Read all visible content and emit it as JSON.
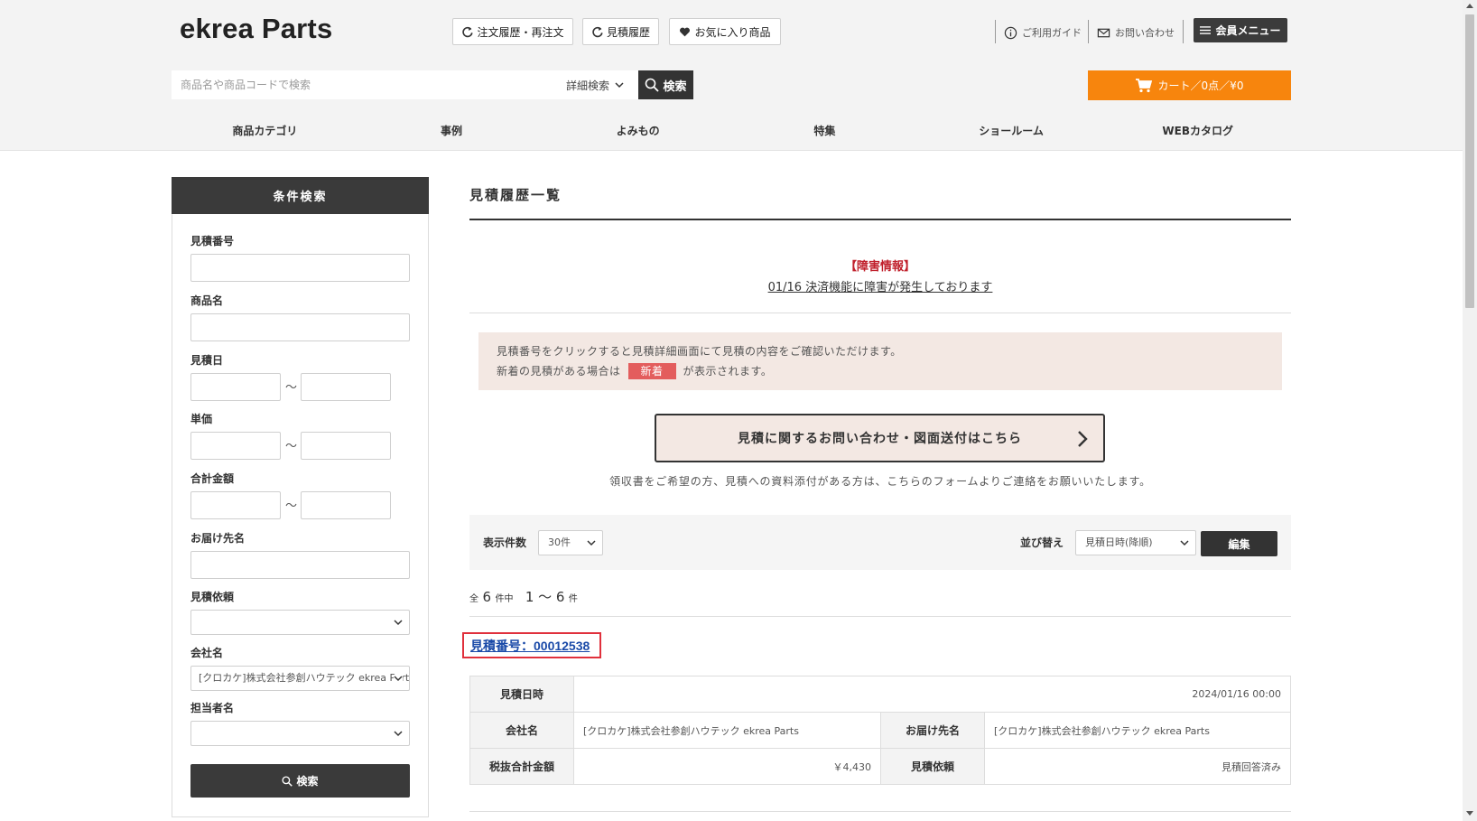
{
  "header": {
    "logo": "ekrea Parts",
    "buttons": {
      "order_history": "注文履歴・再注文",
      "quote_history": "見積履歴",
      "favorites": "お気に入り商品"
    },
    "utility": {
      "guide": "ご利用ガイド",
      "contact": "お問い合わせ",
      "member_menu": "会員メニュー"
    },
    "search": {
      "placeholder": "商品名や商品コードで検索",
      "detail": "詳細検索",
      "button": "検索"
    },
    "cart": "カート／0点／¥0",
    "nav": [
      "商品カテゴリ",
      "事例",
      "よみもの",
      "特集",
      "ショールーム",
      "WEBカタログ"
    ]
  },
  "sidebar": {
    "title": "条件検索",
    "fields": {
      "quote_number": "見積番号",
      "product_name": "商品名",
      "quote_date": "見積日",
      "unit_price": "単価",
      "total_amount": "合計金額",
      "delivery_name": "お届け先名",
      "quote_request": "見積依頼",
      "company_name": "会社名",
      "person_name": "担当者名"
    },
    "tilde": "～",
    "company_value": "[クロカケ]株式会社参創ハウテック ekrea Parts",
    "search_button": "検索"
  },
  "main": {
    "title": "見積履歴一覧",
    "alert_tag": "【障害情報】",
    "alert_link": "01/16 決済機能に障害が発生しております",
    "notice_line1": "見積番号をクリックすると見積詳細画面にて見積の内容をご確認いただけます。",
    "notice_line2_pre": "新着の見積がある場合は",
    "notice_badge": "新着",
    "notice_line2_post": "が表示されます。",
    "contact_button": "見積に関するお問い合わせ・図面送付はこちら",
    "contact_note": "領収書をご希望の方、見積への資料添付がある方は、こちらのフォームよりご連絡をお願いいたします。",
    "toolbar": {
      "per_page_label": "表示件数",
      "per_page_value": "30件",
      "sort_label": "並び替え",
      "sort_value": "見積日時(降順)",
      "edit_button": "編集"
    },
    "count": {
      "prefix": "全",
      "total": "6",
      "suffix": "件中",
      "range": "1 ～ 6",
      "range_suffix": "件"
    },
    "quote": {
      "link": "見積番号：00012538",
      "labels": {
        "date": "見積日時",
        "company": "会社名",
        "delivery": "お届け先名",
        "subtotal": "税抜合計金額",
        "request": "見積依頼"
      },
      "values": {
        "date": "2024/01/16 00:00",
        "company": "[クロカケ]株式会社参創ハウテック ekrea Parts",
        "delivery": "[クロカケ]株式会社参創ハウテック ekrea Parts",
        "subtotal": "￥4,430",
        "request": "見積回答済み"
      }
    }
  }
}
